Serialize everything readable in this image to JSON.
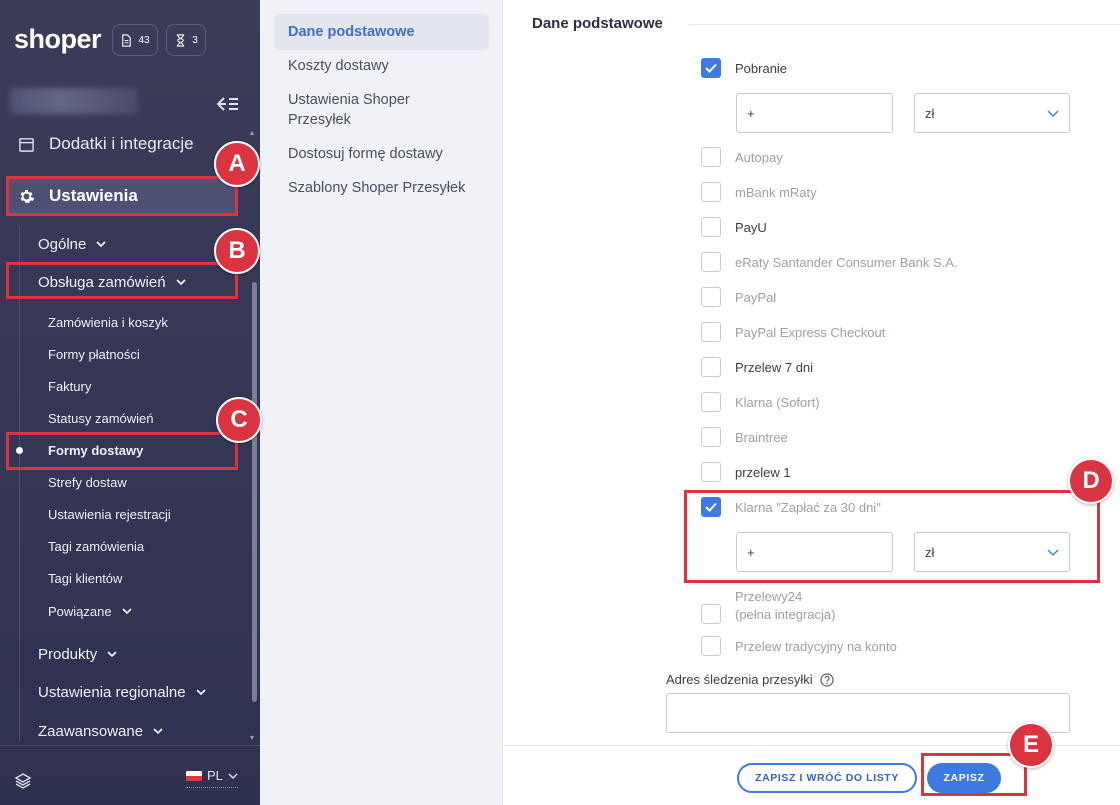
{
  "brand": {
    "logo": "shoper",
    "accent": "#3d7be0",
    "annotation_color": "#d9343f"
  },
  "sidebar": {
    "docs_count": "43",
    "timer_count": "3",
    "addons_label": "Dodatki i integracje",
    "settings_label": "Ustawienia",
    "groups": {
      "general": "Ogólne",
      "orders": "Obsługa zamówień",
      "products": "Produkty",
      "regional": "Ustawienia regionalne",
      "advanced": "Zaawansowane"
    },
    "orders_items": [
      "Zamówienia i koszyk",
      "Formy płatności",
      "Faktury",
      "Statusy zamówień",
      "Formy dostawy",
      "Strefy dostaw",
      "Ustawienia rejestracji",
      "Tagi zamówienia",
      "Tagi klientów",
      "Powiązane"
    ],
    "language": "PL"
  },
  "subnav": {
    "items": [
      "Dane podstawowe",
      "Koszty dostawy",
      "Ustawienia Shoper Przesyłek",
      "Dostosuj formę dostawy",
      "Szablony Shoper Przesyłek"
    ]
  },
  "main": {
    "section_title": "Dane podstawowe",
    "payments": [
      {
        "label": "Pobranie",
        "checked": true
      },
      {
        "label": "Autopay",
        "checked": false
      },
      {
        "label": "mBank mRaty",
        "checked": false
      },
      {
        "label": "PayU",
        "checked": false
      },
      {
        "label": "eRaty Santander Consumer Bank S.A.",
        "checked": false
      },
      {
        "label": "PayPal",
        "checked": false
      },
      {
        "label": "PayPal Express Checkout",
        "checked": false
      },
      {
        "label": "Przelew 7 dni",
        "checked": false
      },
      {
        "label": "Klarna (Sofort)",
        "checked": false
      },
      {
        "label": "Braintree",
        "checked": false
      },
      {
        "label": "przelew 1",
        "checked": false
      },
      {
        "label": "Klarna \"Zapłać za 30 dni\"",
        "checked": true
      },
      {
        "label": "Przelewy24",
        "label2": "(pełna integracja)",
        "checked": false
      },
      {
        "label": "Przelew tradycyjny na konto",
        "checked": false
      }
    ],
    "fee_sign": "+",
    "currency": "zł",
    "tracking_label": "Adres śledzenia przesyłki",
    "tracking_value": ""
  },
  "footer": {
    "save_back_label": "ZAPISZ I WRÓĆ DO LISTY",
    "save_label": "ZAPISZ"
  },
  "annotations": [
    "A",
    "B",
    "C",
    "D",
    "E"
  ]
}
